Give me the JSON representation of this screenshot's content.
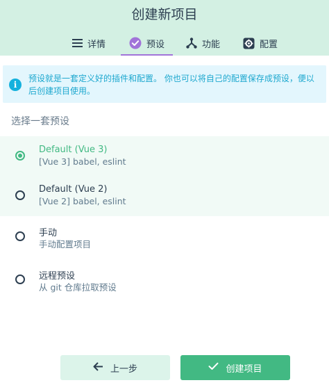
{
  "title": "创建新项目",
  "tabs": [
    {
      "label": "详情",
      "icon": "list-icon"
    },
    {
      "label": "预设",
      "icon": "check-circle-icon",
      "active": true
    },
    {
      "label": "功能",
      "icon": "fork-icon"
    },
    {
      "label": "配置",
      "icon": "settings-icon"
    }
  ],
  "info": {
    "icon": "info-icon",
    "text": "预设就是一套定义好的插件和配置。 你也可以将自己的配置保存成预设，便以后创建项目使用。"
  },
  "section_title": "选择一套预设",
  "presets": [
    {
      "name": "Default (Vue 3)",
      "desc": "[Vue 3] babel, eslint",
      "selected": true
    },
    {
      "name": "Default (Vue 2)",
      "desc": "[Vue 2] babel, eslint",
      "selected": false
    },
    {
      "name": "手动",
      "desc": "手动配置项目",
      "selected": false
    },
    {
      "name": "远程预设",
      "desc": "从 git 仓库拉取预设",
      "selected": false
    }
  ],
  "buttons": {
    "prev_label": "上一步",
    "create_label": "创建项目"
  },
  "colors": {
    "header_bg": "#d3f0e3",
    "accent": "#42b983",
    "tab_underline": "#a173d9",
    "info_text": "#1ea8cf"
  }
}
